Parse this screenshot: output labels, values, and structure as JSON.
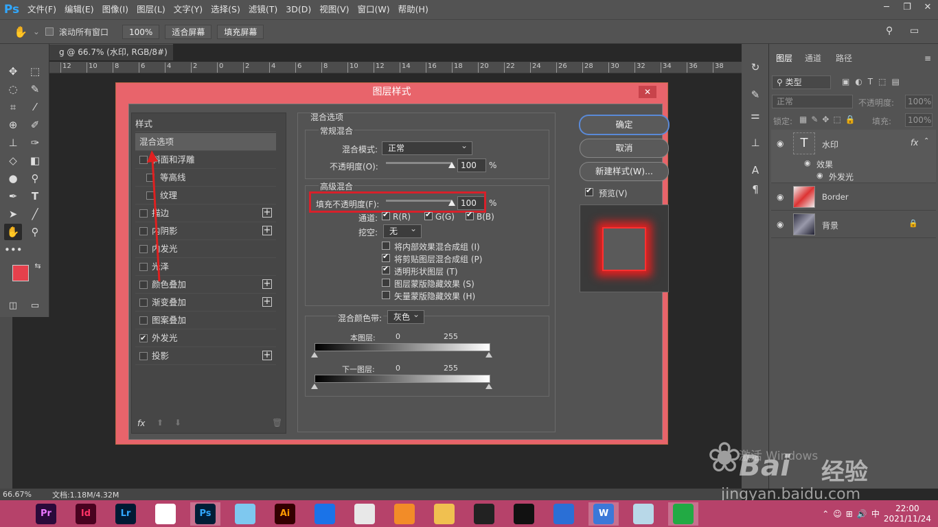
{
  "app": {
    "logo": "Ps"
  },
  "menu": [
    "文件(F)",
    "编辑(E)",
    "图像(I)",
    "图层(L)",
    "文字(Y)",
    "选择(S)",
    "滤镜(T)",
    "3D(D)",
    "视图(V)",
    "窗口(W)",
    "帮助(H)"
  ],
  "window_controls": [
    "minimize-icon",
    "restore-icon",
    "close-icon"
  ],
  "options_bar": {
    "scroll_all": "滚动所有窗口",
    "zoom": "100%",
    "fit_screen": "适合屏幕",
    "fill_screen": "填充屏幕"
  },
  "document": {
    "tab_title": "g @ 66.7% (水印, RGB/8#) *",
    "zoom_status": "66.67%",
    "doc_info": "文档:1.18M/4.32M"
  },
  "ruler": {
    "h_ticks": [
      "12",
      "10",
      "8",
      "6",
      "4",
      "2",
      "0",
      "2",
      "4",
      "6",
      "8",
      "10",
      "12",
      "14",
      "16",
      "18",
      "20",
      "22",
      "24",
      "26",
      "28",
      "30",
      "32",
      "34",
      "36",
      "38"
    ]
  },
  "colors": {
    "foreground": "#e5404c",
    "background": "#ffffff",
    "dialog_frame": "#e8646b",
    "accent_red": "#d8202a",
    "panel": "#535353",
    "taskbar": "#b6426a"
  },
  "dialog": {
    "title": "图层样式",
    "style_header": "样式",
    "styles": [
      {
        "label": "混合选项",
        "checkbox": false,
        "checked": false,
        "plus": false,
        "indent": false
      },
      {
        "label": "斜面和浮雕",
        "checkbox": true,
        "checked": false,
        "plus": false,
        "indent": false
      },
      {
        "label": "等高线",
        "checkbox": true,
        "checked": false,
        "plus": false,
        "indent": true
      },
      {
        "label": "纹理",
        "checkbox": true,
        "checked": false,
        "plus": false,
        "indent": true
      },
      {
        "label": "描边",
        "checkbox": true,
        "checked": false,
        "plus": true,
        "indent": false
      },
      {
        "label": "内阴影",
        "checkbox": true,
        "checked": false,
        "plus": true,
        "indent": false
      },
      {
        "label": "内发光",
        "checkbox": true,
        "checked": false,
        "plus": false,
        "indent": false
      },
      {
        "label": "光泽",
        "checkbox": true,
        "checked": false,
        "plus": false,
        "indent": false
      },
      {
        "label": "颜色叠加",
        "checkbox": true,
        "checked": false,
        "plus": true,
        "indent": false
      },
      {
        "label": "渐变叠加",
        "checkbox": true,
        "checked": false,
        "plus": true,
        "indent": false
      },
      {
        "label": "图案叠加",
        "checkbox": true,
        "checked": false,
        "plus": false,
        "indent": false
      },
      {
        "label": "外发光",
        "checkbox": true,
        "checked": true,
        "plus": false,
        "indent": false
      },
      {
        "label": "投影",
        "checkbox": true,
        "checked": false,
        "plus": true,
        "indent": false
      }
    ],
    "fx_label": "fx",
    "blend_options_title": "混合选项",
    "general_blend": {
      "title": "常规混合",
      "mode_label": "混合模式:",
      "mode_value": "正常",
      "opacity_label": "不透明度(O):",
      "opacity_value": "100",
      "opacity_unit": "%"
    },
    "advanced_blend": {
      "title": "高级混合",
      "fill_label": "填充不透明度(F):",
      "fill_value": "100",
      "fill_unit": "%",
      "channels_label": "通道:",
      "channels": [
        "R(R)",
        "G(G)",
        "B(B)"
      ],
      "knockout_label": "挖空:",
      "knockout_value": "无",
      "options": [
        {
          "label": "将内部效果混合成组 (I)",
          "checked": false
        },
        {
          "label": "将剪贴图层混合成组 (P)",
          "checked": true
        },
        {
          "label": "透明形状图层 (T)",
          "checked": true
        },
        {
          "label": "图层蒙版隐藏效果 (S)",
          "checked": false
        },
        {
          "label": "矢量蒙版隐藏效果 (H)",
          "checked": false
        }
      ]
    },
    "blend_if": {
      "label": "混合颜色带:",
      "value": "灰色",
      "this_layer": "本图层:",
      "underlying": "下一图层:",
      "min": "0",
      "max": "255"
    },
    "buttons": {
      "ok": "确定",
      "cancel": "取消",
      "new_style": "新建样式(W)...",
      "preview": "预览(V)"
    }
  },
  "layers_panel": {
    "tabs": [
      "图层",
      "通道",
      "路径"
    ],
    "filter_kind": "类型",
    "blend_mode": "正常",
    "opacity_label": "不透明度:",
    "opacity_value": "100%",
    "lock_label": "锁定:",
    "fill_label": "填充:",
    "fill_value": "100%",
    "layers": [
      {
        "name": "水印",
        "type": "text",
        "fx": "fx"
      },
      {
        "name": "Border",
        "type": "image"
      },
      {
        "name": "背景",
        "type": "image",
        "locked": true
      }
    ],
    "effects_label": "效果",
    "effect_item": "外发光"
  },
  "taskbar": {
    "apps": [
      {
        "label": "Pr",
        "color": "#2a0a3a",
        "fg": "#ea77ff"
      },
      {
        "label": "Id",
        "color": "#49021f",
        "fg": "#ff3366"
      },
      {
        "label": "Lr",
        "color": "#001a33",
        "fg": "#31a8ff"
      },
      {
        "label": "",
        "color": "#ffffff",
        "fg": "#d22"
      },
      {
        "label": "Ps",
        "color": "#001e36",
        "fg": "#31a8ff"
      },
      {
        "label": "",
        "color": "#7ec8ef",
        "fg": "#fff"
      },
      {
        "label": "Ai",
        "color": "#330000",
        "fg": "#ff9a00"
      },
      {
        "label": "",
        "color": "#1a73e8",
        "fg": "#fff"
      },
      {
        "label": "",
        "color": "#e8e8e8",
        "fg": "#db4437"
      },
      {
        "label": "",
        "color": "#f28c28",
        "fg": "#fff"
      },
      {
        "label": "",
        "color": "#f0c050",
        "fg": "#333"
      },
      {
        "label": "",
        "color": "#222222",
        "fg": "#fff"
      },
      {
        "label": "",
        "color": "#111111",
        "fg": "#fff"
      },
      {
        "label": "",
        "color": "#2a6fd6",
        "fg": "#fff"
      },
      {
        "label": "W",
        "color": "#3c78d8",
        "fg": "#fff"
      },
      {
        "label": "",
        "color": "#b8d8e8",
        "fg": "#333"
      },
      {
        "label": "",
        "color": "#22aa44",
        "fg": "#fff"
      }
    ],
    "ime": "中",
    "time": "22:00",
    "date": "2021/11/24"
  },
  "watermark": {
    "activate": "激活 Windows",
    "brand": "Bai",
    "brand2": "经验",
    "url": "jingyan.baidu.com"
  }
}
